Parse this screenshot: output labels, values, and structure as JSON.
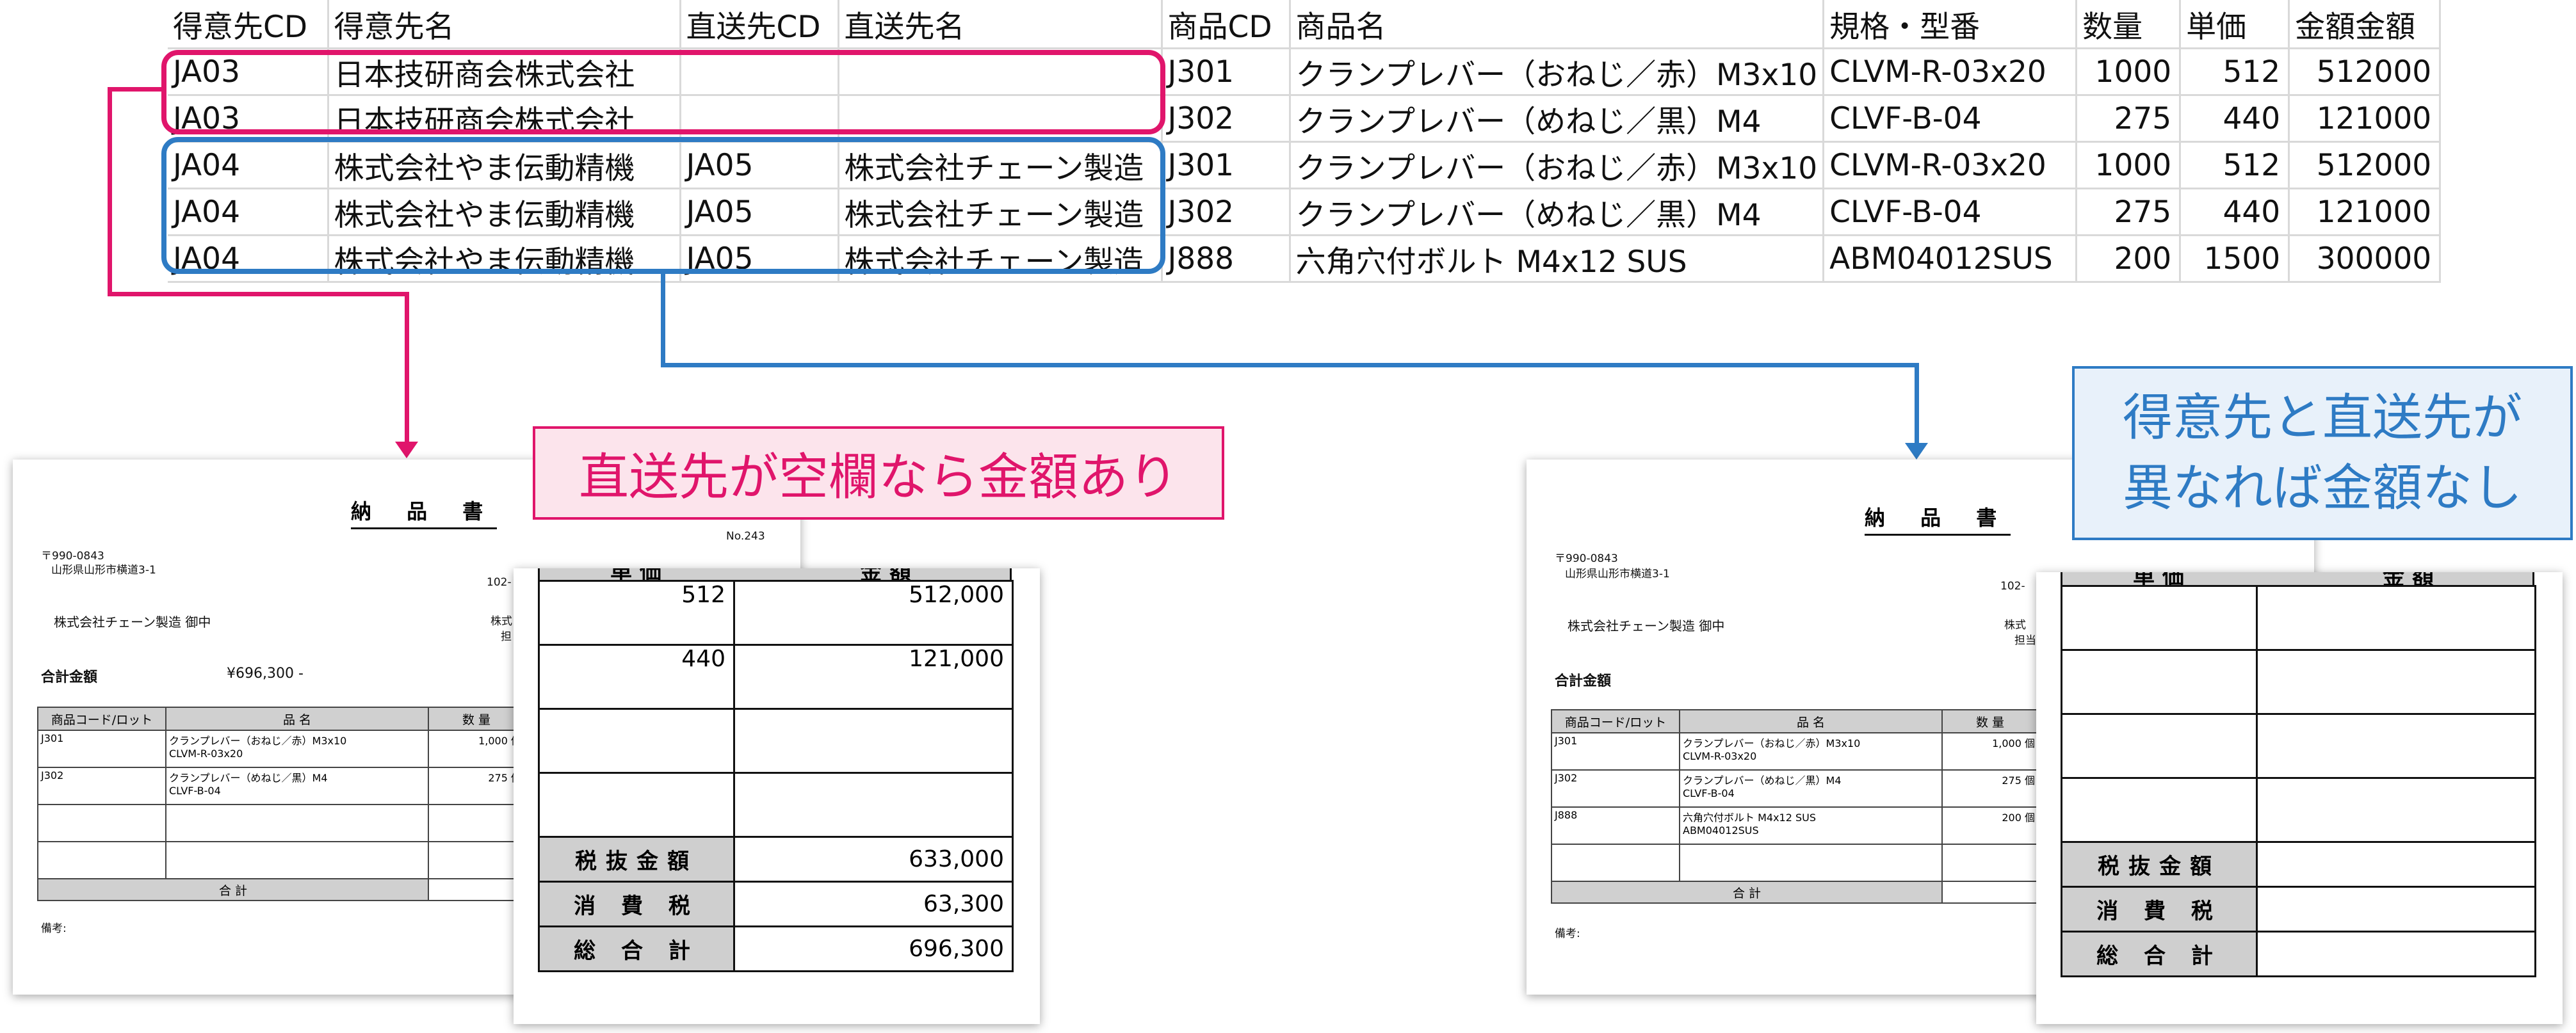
{
  "sheet": {
    "headers": [
      "得意先CD",
      "得意先名",
      "直送先CD",
      "直送先名",
      "商品CD",
      "商品名",
      "規格・型番",
      "数量",
      "単価",
      "金額金額"
    ],
    "rows": [
      [
        "JA03",
        "日本技研商会株式会社",
        "",
        "",
        "J301",
        "クランプレバー（おねじ／赤）M3x10",
        "CLVM-R-03x20",
        "1000",
        "512",
        "512000"
      ],
      [
        "JA03",
        "日本技研商会株式会社",
        "",
        "",
        "J302",
        "クランプレバー（めねじ／黒）M4",
        "CLVF-B-04",
        "275",
        "440",
        "121000"
      ],
      [
        "JA04",
        "株式会社やま伝動精機",
        "JA05",
        "株式会社チェーン製造",
        "J301",
        "クランプレバー（おねじ／赤）M3x10",
        "CLVM-R-03x20",
        "1000",
        "512",
        "512000"
      ],
      [
        "JA04",
        "株式会社やま伝動精機",
        "JA05",
        "株式会社チェーン製造",
        "J302",
        "クランプレバー（めねじ／黒）M4",
        "CLVF-B-04",
        "275",
        "440",
        "121000"
      ],
      [
        "JA04",
        "株式会社やま伝動精機",
        "JA05",
        "株式会社チェーン製造",
        "J888",
        "六角穴付ボルト M4x12 SUS",
        "ABM04012SUS",
        "200",
        "1500",
        "300000"
      ]
    ]
  },
  "colors": {
    "pink": "#e0156b",
    "blue": "#2e7bc4",
    "pink_bg": "#fce4ec",
    "blue_bg": "#e8f1fa",
    "header_gray": "#d0d0d0"
  },
  "callouts": {
    "left": "直送先が空欄なら金額あり",
    "right_line1": "得意先と直送先が",
    "right_line2": "異なれば金額なし"
  },
  "doc_left": {
    "title": "納 品 書",
    "number": "No.243",
    "postal": "〒990-0843",
    "address": "山形県山形市横道3-1",
    "recipient": "株式会社チェーン製造 御中",
    "total_label": "合計金額",
    "total_value": "¥696,300 -",
    "side_code": "102-",
    "side_a": "株式",
    "side_b": "担",
    "col_code": "商品コード/ロット",
    "col_name": "品 名",
    "col_qty": "数 量",
    "items": [
      {
        "code": "J301",
        "name1": "クランプレバー（おねじ／赤）M3x10",
        "name2": "CLVM-R-03x20",
        "qty": "1,000 個"
      },
      {
        "code": "J302",
        "name1": "クランプレバー（めねじ／黒）M4",
        "name2": "CLVF-B-04",
        "qty": "275 個"
      }
    ],
    "sum_label": "合 計",
    "remarks": "備考:"
  },
  "zoom_left": {
    "head_unit": "単 価",
    "head_amount": "金 額",
    "rows": [
      {
        "unit": "512",
        "amount": "512,000"
      },
      {
        "unit": "440",
        "amount": "121,000"
      },
      {
        "unit": "",
        "amount": ""
      },
      {
        "unit": "",
        "amount": ""
      }
    ],
    "subtotal_label": "税抜金額",
    "subtotal": "633,000",
    "tax_label": "消 費 税",
    "tax": "63,300",
    "grand_label": "総 合 計",
    "grand": "696,300"
  },
  "doc_right": {
    "title": "納 品 書",
    "number": "No.243",
    "postal": "〒990-0843",
    "address": "山形県山形市横道3-1",
    "recipient": "株式会社チェーン製造 御中",
    "total_label": "合計金額",
    "side_code": "102-",
    "side_a": "株式",
    "side_b": "担当",
    "col_code": "商品コード/ロット",
    "col_name": "品 名",
    "col_qty": "数 量",
    "items": [
      {
        "code": "J301",
        "name1": "クランプレバー（おねじ／赤）M3x10",
        "name2": "CLVM-R-03x20",
        "qty": "1,000 個"
      },
      {
        "code": "J302",
        "name1": "クランプレバー（めねじ／黒）M4",
        "name2": "CLVF-B-04",
        "qty": "275 個"
      },
      {
        "code": "J888",
        "name1": "六角穴付ボルト M4x12 SUS",
        "name2": "ABM04012SUS",
        "qty": "200 個"
      }
    ],
    "sum_label": "合 計",
    "remarks": "備考:"
  },
  "zoom_right": {
    "head_unit": "単 価",
    "head_amount": "金 額",
    "subtotal_label": "税抜金額",
    "tax_label": "消 費 税",
    "grand_label": "総 合 計"
  }
}
